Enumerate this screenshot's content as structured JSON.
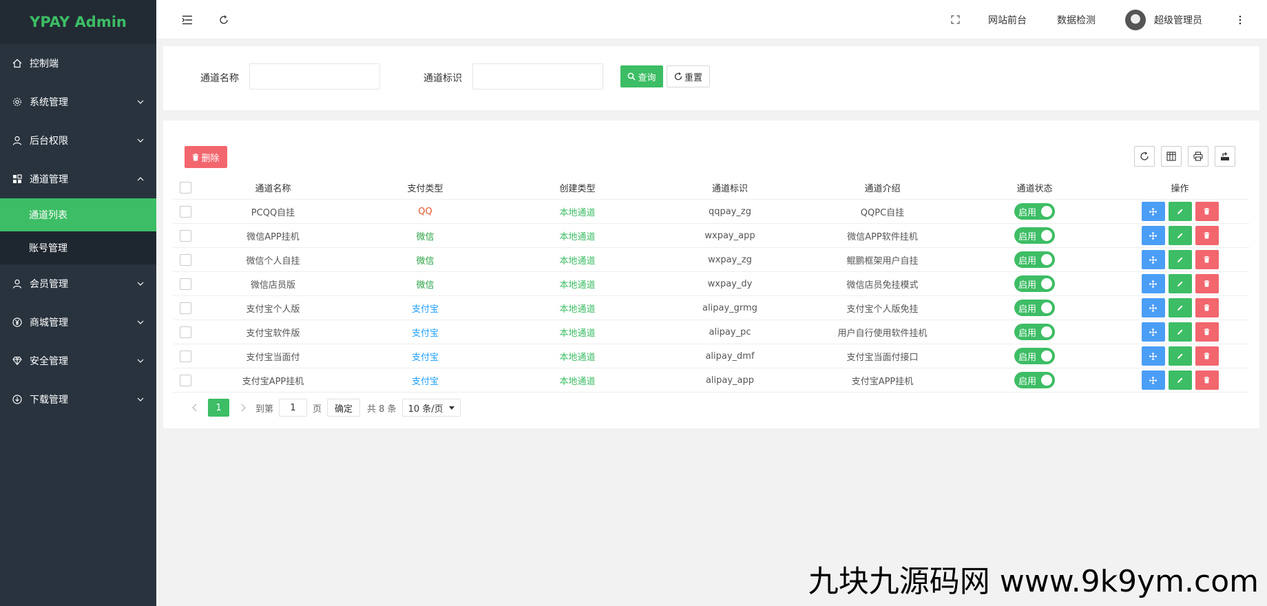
{
  "brand": "YPAY Admin",
  "sidebar": {
    "items": [
      {
        "label": "控制端",
        "icon": "home-icon"
      },
      {
        "label": "系统管理",
        "icon": "gear-icon"
      },
      {
        "label": "后台权限",
        "icon": "user-icon"
      },
      {
        "label": "通道管理",
        "icon": "grid-icon"
      },
      {
        "label": "会员管理",
        "icon": "user-icon"
      },
      {
        "label": "商城管理",
        "icon": "yen-icon"
      },
      {
        "label": "安全管理",
        "icon": "diamond-icon"
      },
      {
        "label": "下载管理",
        "icon": "download-icon"
      }
    ],
    "subitems": [
      {
        "label": "通道列表"
      },
      {
        "label": "账号管理"
      }
    ]
  },
  "header": {
    "links": [
      "网站前台",
      "数据检测"
    ],
    "user": "超级管理员"
  },
  "search": {
    "name_label": "通道名称",
    "id_label": "通道标识",
    "query_label": "查询",
    "reset_label": "重置"
  },
  "toolbar": {
    "delete_label": "删除"
  },
  "colors": {
    "accent": "#3dbd65",
    "sidebar": "#28333e",
    "danger": "#f2666e",
    "info": "#4b9ef6",
    "qq": "#e8532a",
    "wechat": "#2ba245",
    "alipay": "#1e9fff"
  },
  "table": {
    "headers": [
      "通道名称",
      "支付类型",
      "创建类型",
      "通道标识",
      "通道介绍",
      "通道状态",
      "操作"
    ],
    "rows": [
      {
        "name": "PCQQ自挂",
        "pay": "QQ",
        "pay_color": "#e8532a",
        "create": "本地通道",
        "ident": "qqpay_zg",
        "intro": "QQPC自挂",
        "status": "启用"
      },
      {
        "name": "微信APP挂机",
        "pay": "微信",
        "pay_color": "#2ba245",
        "create": "本地通道",
        "ident": "wxpay_app",
        "intro": "微信APP软件挂机",
        "status": "启用"
      },
      {
        "name": "微信个人自挂",
        "pay": "微信",
        "pay_color": "#2ba245",
        "create": "本地通道",
        "ident": "wxpay_zg",
        "intro": "鲲鹏框架用户自挂",
        "status": "启用"
      },
      {
        "name": "微信店员版",
        "pay": "微信",
        "pay_color": "#2ba245",
        "create": "本地通道",
        "ident": "wxpay_dy",
        "intro": "微信店员免挂模式",
        "status": "启用"
      },
      {
        "name": "支付宝个人版",
        "pay": "支付宝",
        "pay_color": "#1e9fff",
        "create": "本地通道",
        "ident": "alipay_grmg",
        "intro": "支付宝个人版免挂",
        "status": "启用"
      },
      {
        "name": "支付宝软件版",
        "pay": "支付宝",
        "pay_color": "#1e9fff",
        "create": "本地通道",
        "ident": "alipay_pc",
        "intro": "用户自行使用软件挂机",
        "status": "启用"
      },
      {
        "name": "支付宝当面付",
        "pay": "支付宝",
        "pay_color": "#1e9fff",
        "create": "本地通道",
        "ident": "alipay_dmf",
        "intro": "支付宝当面付接口",
        "status": "启用"
      },
      {
        "name": "支付宝APP挂机",
        "pay": "支付宝",
        "pay_color": "#1e9fff",
        "create": "本地通道",
        "ident": "alipay_app",
        "intro": "支付宝APP挂机",
        "status": "启用"
      }
    ]
  },
  "pagination": {
    "current": "1",
    "goto_label": "到第",
    "goto_value": "1",
    "page_label": "页",
    "confirm_label": "确定",
    "total_label": "共 8 条",
    "per_page": "10 条/页"
  },
  "watermark": "九块九源码网 www.9k9ym.com"
}
